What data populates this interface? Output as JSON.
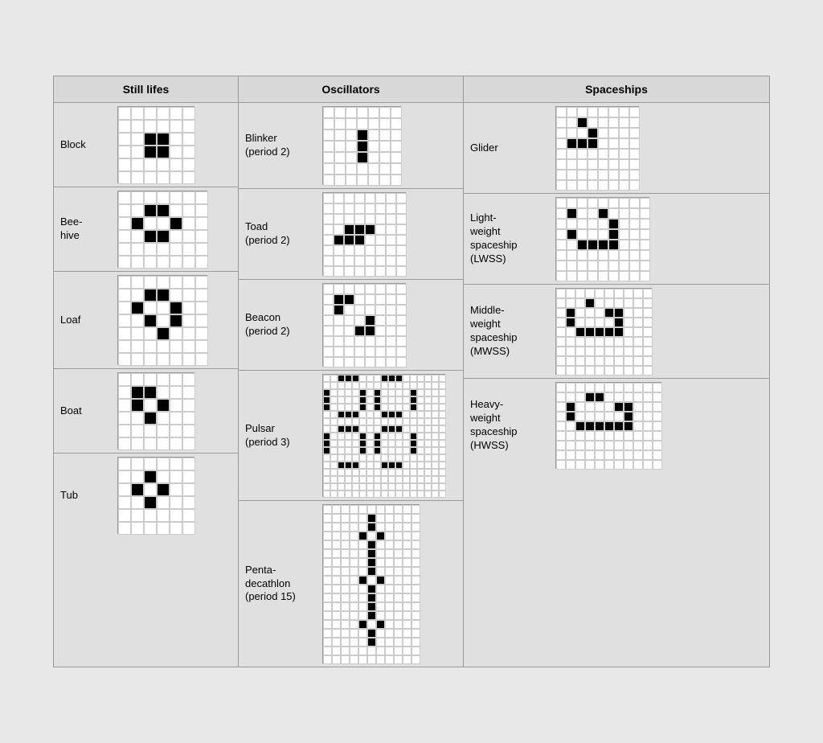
{
  "sections": {
    "still_lifes": {
      "header": "Still lifes",
      "patterns": [
        {
          "name": "Block",
          "cols": 6,
          "rows": 6,
          "alive": [
            [
              2,
              2
            ],
            [
              2,
              3
            ],
            [
              3,
              2
            ],
            [
              3,
              3
            ]
          ]
        },
        {
          "name": "Bee-\nhive",
          "cols": 7,
          "rows": 6,
          "alive": [
            [
              2,
              1
            ],
            [
              3,
              1
            ],
            [
              1,
              2
            ],
            [
              4,
              2
            ],
            [
              2,
              3
            ],
            [
              3,
              3
            ]
          ]
        },
        {
          "name": "Loaf",
          "cols": 7,
          "rows": 7,
          "alive": [
            [
              2,
              1
            ],
            [
              3,
              1
            ],
            [
              1,
              2
            ],
            [
              4,
              2
            ],
            [
              2,
              3
            ],
            [
              4,
              3
            ],
            [
              3,
              4
            ]
          ]
        },
        {
          "name": "Boat",
          "cols": 6,
          "rows": 6,
          "alive": [
            [
              1,
              1
            ],
            [
              2,
              1
            ],
            [
              1,
              2
            ],
            [
              3,
              2
            ],
            [
              2,
              3
            ]
          ]
        },
        {
          "name": "Tub",
          "cols": 6,
          "rows": 6,
          "alive": [
            [
              2,
              1
            ],
            [
              1,
              2
            ],
            [
              3,
              2
            ],
            [
              2,
              3
            ]
          ]
        }
      ]
    },
    "oscillators": {
      "header": "Oscillators",
      "patterns": [
        {
          "name": "Blinker\n(period 2)",
          "cols": 7,
          "rows": 7,
          "alive": [
            [
              3,
              2
            ],
            [
              3,
              3
            ],
            [
              3,
              4
            ]
          ]
        },
        {
          "name": "Toad\n(period 2)",
          "cols": 8,
          "rows": 8,
          "alive": [
            [
              2,
              3
            ],
            [
              3,
              3
            ],
            [
              4,
              3
            ],
            [
              1,
              4
            ],
            [
              2,
              4
            ],
            [
              3,
              4
            ]
          ]
        },
        {
          "name": "Beacon\n(period 2)",
          "cols": 8,
          "rows": 8,
          "alive": [
            [
              1,
              1
            ],
            [
              2,
              1
            ],
            [
              1,
              2
            ],
            [
              4,
              3
            ],
            [
              3,
              4
            ],
            [
              4,
              4
            ]
          ]
        },
        {
          "name": "Pulsar\n(period 3)",
          "cols": 17,
          "rows": 17,
          "alive": [
            [
              2,
              0
            ],
            [
              3,
              0
            ],
            [
              4,
              0
            ],
            [
              8,
              0
            ],
            [
              9,
              0
            ],
            [
              10,
              0
            ],
            [
              0,
              2
            ],
            [
              5,
              2
            ],
            [
              7,
              2
            ],
            [
              12,
              2
            ],
            [
              0,
              3
            ],
            [
              5,
              3
            ],
            [
              7,
              3
            ],
            [
              12,
              3
            ],
            [
              0,
              4
            ],
            [
              5,
              4
            ],
            [
              7,
              4
            ],
            [
              12,
              4
            ],
            [
              2,
              5
            ],
            [
              3,
              5
            ],
            [
              4,
              5
            ],
            [
              8,
              5
            ],
            [
              9,
              5
            ],
            [
              10,
              5
            ],
            [
              2,
              7
            ],
            [
              3,
              7
            ],
            [
              4,
              7
            ],
            [
              8,
              7
            ],
            [
              9,
              7
            ],
            [
              10,
              7
            ],
            [
              0,
              8
            ],
            [
              5,
              8
            ],
            [
              7,
              8
            ],
            [
              12,
              8
            ],
            [
              0,
              9
            ],
            [
              5,
              9
            ],
            [
              7,
              9
            ],
            [
              12,
              9
            ],
            [
              0,
              10
            ],
            [
              5,
              10
            ],
            [
              7,
              10
            ],
            [
              12,
              10
            ],
            [
              2,
              12
            ],
            [
              3,
              12
            ],
            [
              4,
              12
            ],
            [
              8,
              12
            ],
            [
              9,
              12
            ],
            [
              10,
              12
            ]
          ]
        },
        {
          "name": "Penta-\ndecathlon\n(period 15)",
          "cols": 11,
          "rows": 18,
          "alive": [
            [
              5,
              1
            ],
            [
              5,
              2
            ],
            [
              4,
              3
            ],
            [
              6,
              3
            ],
            [
              5,
              4
            ],
            [
              5,
              5
            ],
            [
              5,
              6
            ],
            [
              5,
              7
            ],
            [
              4,
              8
            ],
            [
              6,
              8
            ],
            [
              5,
              9
            ],
            [
              5,
              10
            ],
            [
              5,
              11
            ],
            [
              5,
              12
            ],
            [
              4,
              13
            ],
            [
              6,
              13
            ],
            [
              5,
              14
            ],
            [
              5,
              15
            ]
          ]
        }
      ]
    },
    "spaceships": {
      "header": "Spaceships",
      "patterns": [
        {
          "name": "Glider",
          "cols": 8,
          "rows": 8,
          "alive": [
            [
              2,
              1
            ],
            [
              3,
              2
            ],
            [
              1,
              3
            ],
            [
              2,
              3
            ],
            [
              3,
              3
            ]
          ]
        },
        {
          "name": "Light-\nweight\nspaceship\n(LWSS)",
          "cols": 9,
          "rows": 8,
          "alive": [
            [
              1,
              1
            ],
            [
              4,
              1
            ],
            [
              5,
              2
            ],
            [
              1,
              3
            ],
            [
              5,
              3
            ],
            [
              2,
              4
            ],
            [
              3,
              4
            ],
            [
              4,
              4
            ],
            [
              5,
              4
            ]
          ]
        },
        {
          "name": "Middle-\nweight\nspaceship\n(MWSS)",
          "cols": 10,
          "rows": 9,
          "alive": [
            [
              3,
              1
            ],
            [
              1,
              2
            ],
            [
              5,
              2
            ],
            [
              6,
              2
            ],
            [
              1,
              3
            ],
            [
              6,
              3
            ],
            [
              2,
              4
            ],
            [
              3,
              4
            ],
            [
              4,
              4
            ],
            [
              5,
              4
            ],
            [
              6,
              4
            ]
          ]
        },
        {
          "name": "Heavy-\nweight\nspaceship\n(HWSS)",
          "cols": 11,
          "rows": 9,
          "alive": [
            [
              3,
              1
            ],
            [
              4,
              1
            ],
            [
              1,
              2
            ],
            [
              6,
              2
            ],
            [
              7,
              2
            ],
            [
              1,
              3
            ],
            [
              7,
              3
            ],
            [
              2,
              4
            ],
            [
              3,
              4
            ],
            [
              4,
              4
            ],
            [
              5,
              4
            ],
            [
              6,
              4
            ],
            [
              7,
              4
            ]
          ]
        }
      ]
    }
  }
}
